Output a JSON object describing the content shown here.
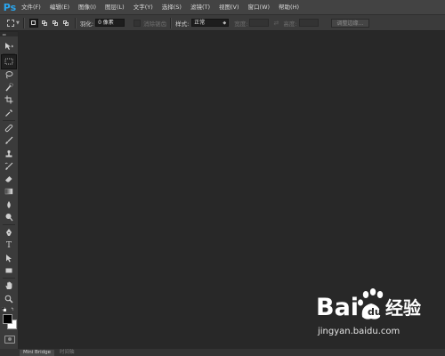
{
  "app": {
    "logo_text": "Ps",
    "brand_color": "#2aa6ef"
  },
  "menu": [
    {
      "label": "文件(F)"
    },
    {
      "label": "编辑(E)"
    },
    {
      "label": "图像(I)"
    },
    {
      "label": "图层(L)"
    },
    {
      "label": "文字(Y)"
    },
    {
      "label": "选择(S)"
    },
    {
      "label": "滤镜(T)"
    },
    {
      "label": "视图(V)"
    },
    {
      "label": "窗口(W)"
    },
    {
      "label": "帮助(H)"
    }
  ],
  "options": {
    "feather_label": "羽化:",
    "feather_value": "0 像素",
    "antialias_label": "消除锯齿",
    "style_label": "样式:",
    "style_value": "正常",
    "width_label": "宽度:",
    "height_label": "高度:",
    "refine_edge_label": "调整边缘..."
  },
  "tools": [
    {
      "icon": "move-icon"
    },
    {
      "icon": "marquee-icon",
      "active": true
    },
    {
      "icon": "lasso-icon"
    },
    {
      "icon": "quick-select-icon"
    },
    {
      "icon": "crop-icon"
    },
    {
      "icon": "eyedropper-icon"
    },
    {
      "icon": "healing-brush-icon"
    },
    {
      "icon": "brush-icon"
    },
    {
      "icon": "clone-stamp-icon"
    },
    {
      "icon": "history-brush-icon"
    },
    {
      "icon": "eraser-icon"
    },
    {
      "icon": "gradient-icon"
    },
    {
      "icon": "blur-icon"
    },
    {
      "icon": "dodge-icon"
    },
    {
      "icon": "pen-icon"
    },
    {
      "icon": "type-icon",
      "glyph": "T"
    },
    {
      "icon": "path-select-icon"
    },
    {
      "icon": "rectangle-shape-icon"
    },
    {
      "icon": "hand-icon"
    },
    {
      "icon": "zoom-icon"
    }
  ],
  "colors": {
    "foreground": "#000000",
    "background": "#ffffff"
  },
  "bottom_tabs": [
    {
      "label": "Mini Bridge",
      "active": true
    },
    {
      "label": "时间轴",
      "active": false
    }
  ],
  "watermark": {
    "brand_text": "Bai",
    "brand_text2": "经验",
    "url": "jingyan.baidu.com"
  }
}
